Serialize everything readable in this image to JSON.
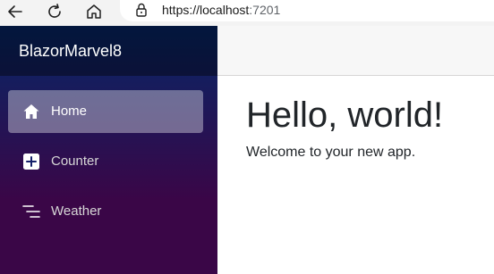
{
  "browser": {
    "url_main": "https://localhost",
    "url_port": ":7201"
  },
  "sidebar": {
    "brand": "BlazorMarvel8",
    "items": [
      {
        "label": "Home",
        "icon": "house-icon",
        "active": true
      },
      {
        "label": "Counter",
        "icon": "plus-square-icon",
        "active": false
      },
      {
        "label": "Weather",
        "icon": "list-icon",
        "active": false
      }
    ]
  },
  "main": {
    "title": "Hello, world!",
    "text": "Welcome to your new app."
  },
  "colors": {
    "sidebar_top": "#052767",
    "sidebar_bottom": "#3a0647",
    "active_item": "rgba(255,255,255,0.37)",
    "text_dark": "#212529"
  }
}
